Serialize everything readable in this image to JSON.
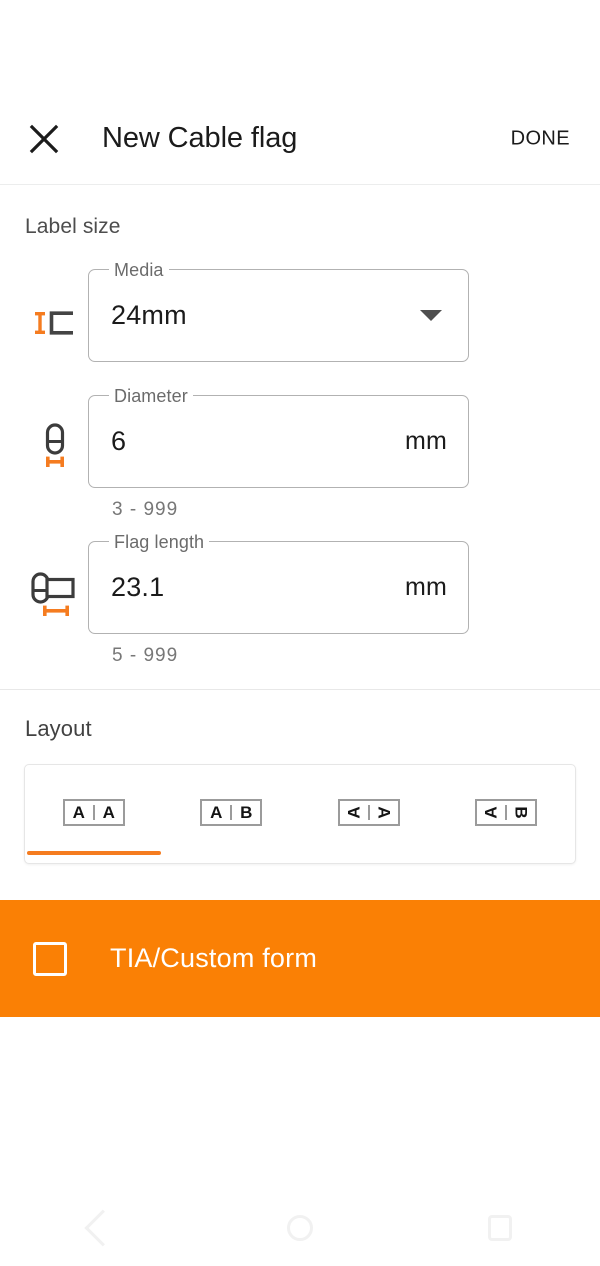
{
  "app_bar": {
    "close_icon": "close-icon",
    "title": "New Cable flag",
    "done_label": "DONE"
  },
  "label_size": {
    "section_title": "Label size",
    "fields": [
      {
        "icon": "media-width-icon",
        "label": "Media",
        "value": "24mm",
        "type": "dropdown",
        "suffix": "",
        "helper": ""
      },
      {
        "icon": "cable-diameter-icon",
        "label": "Diameter",
        "value": "6",
        "type": "number",
        "suffix": "mm",
        "helper": "3 - 999"
      },
      {
        "icon": "flag-length-icon",
        "label": "Flag length",
        "value": "23.1",
        "type": "number",
        "suffix": "mm",
        "helper": "5 - 999"
      }
    ]
  },
  "layout": {
    "section_title": "Layout",
    "selected_index": 0,
    "options": [
      {
        "name": "layout-a-a",
        "left": "A",
        "right": "A",
        "left_rotation": "none",
        "right_rotation": "none"
      },
      {
        "name": "layout-a-b",
        "left": "A",
        "right": "B",
        "left_rotation": "none",
        "right_rotation": "none"
      },
      {
        "name": "layout-a-a-rotated",
        "left": "A",
        "right": "A",
        "left_rotation": "ccw",
        "right_rotation": "cw"
      },
      {
        "name": "layout-a-b-rotated",
        "left": "A",
        "right": "B",
        "left_rotation": "ccw",
        "right_rotation": "cw"
      }
    ]
  },
  "tia_banner": {
    "label": "TIA/Custom form",
    "checked": false,
    "background_color": "#FA8005"
  },
  "nav_bar": {
    "back": "back-icon",
    "home": "home-icon",
    "recents": "recents-icon"
  },
  "colors": {
    "accent_orange": "#F57C20",
    "banner_orange": "#FA8005",
    "text_primary": "#1b1b1b",
    "text_secondary": "#6b6b6b",
    "field_border": "#b2b2b2"
  }
}
